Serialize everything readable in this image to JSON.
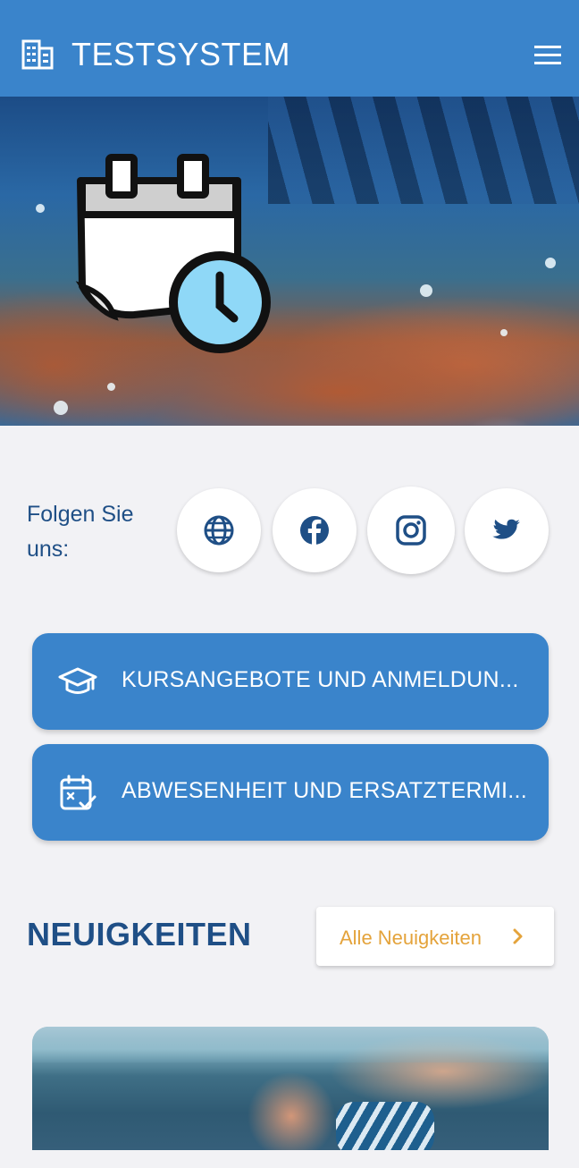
{
  "header": {
    "title": "TESTSYSTEM",
    "logo_icon": "building-icon",
    "menu_icon": "hamburger-menu-icon",
    "background_color": "#3a84cb"
  },
  "hero": {
    "illustration": "calendar-clock-icon"
  },
  "social": {
    "label": "Folgen Sie uns:",
    "items": [
      {
        "icon": "globe-icon"
      },
      {
        "icon": "facebook-icon"
      },
      {
        "icon": "instagram-icon"
      },
      {
        "icon": "twitter-icon"
      }
    ],
    "icon_color": "#1f4f86"
  },
  "actions": [
    {
      "label": "KURSANGEBOTE UND ANMELDUN...",
      "icon": "graduation-cap-icon"
    },
    {
      "label": "ABWESENHEIT UND ERSATZTERMI...",
      "icon": "calendar-check-icon"
    }
  ],
  "news": {
    "title": "NEUIGKEITEN",
    "all_news_label": "Alle Neuigkeiten",
    "all_news_color": "#e4a33b"
  }
}
